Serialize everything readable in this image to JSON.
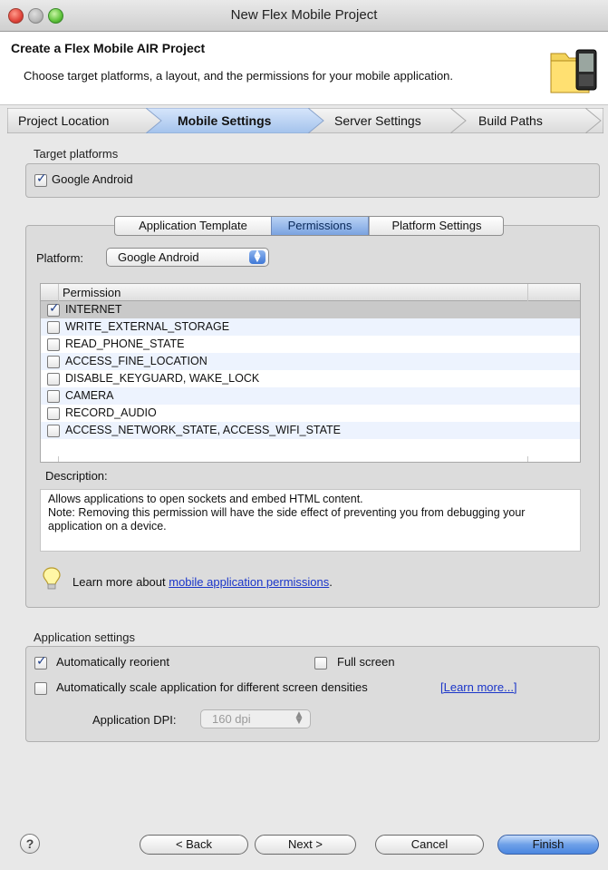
{
  "window": {
    "title": "New Flex Mobile Project"
  },
  "header": {
    "title": "Create a Flex Mobile AIR Project",
    "description": "Choose target platforms, a layout, and the permissions for your mobile application."
  },
  "breadcrumb": [
    {
      "label": "Project Location",
      "selected": false
    },
    {
      "label": "Mobile Settings",
      "selected": true
    },
    {
      "label": "Server Settings",
      "selected": false
    },
    {
      "label": "Build Paths",
      "selected": false
    }
  ],
  "target_platforms": {
    "label": "Target platforms",
    "items": [
      {
        "label": "Google Android",
        "checked": true
      }
    ]
  },
  "inner_tabs": [
    {
      "label": "Application Template",
      "selected": false
    },
    {
      "label": "Permissions",
      "selected": true
    },
    {
      "label": "Platform Settings",
      "selected": false
    }
  ],
  "platform": {
    "label": "Platform:",
    "value": "Google Android"
  },
  "permissions": {
    "column_header": "Permission",
    "rows": [
      {
        "name": "INTERNET",
        "checked": true,
        "selected": true
      },
      {
        "name": "WRITE_EXTERNAL_STORAGE",
        "checked": false,
        "selected": false
      },
      {
        "name": "READ_PHONE_STATE",
        "checked": false,
        "selected": false
      },
      {
        "name": "ACCESS_FINE_LOCATION",
        "checked": false,
        "selected": false
      },
      {
        "name": "DISABLE_KEYGUARD, WAKE_LOCK",
        "checked": false,
        "selected": false
      },
      {
        "name": "CAMERA",
        "checked": false,
        "selected": false
      },
      {
        "name": "RECORD_AUDIO",
        "checked": false,
        "selected": false
      },
      {
        "name": "ACCESS_NETWORK_STATE, ACCESS_WIFI_STATE",
        "checked": false,
        "selected": false
      }
    ]
  },
  "description": {
    "label": "Description:",
    "text_line1": "Allows applications to open sockets and embed HTML content.",
    "text_line2": "Note: Removing this permission will have the side effect of preventing you from debugging your application on a device."
  },
  "learn_more": {
    "prefix": "Learn more about ",
    "link": "mobile application permissions",
    "suffix": "."
  },
  "application_settings": {
    "label": "Application settings",
    "auto_reorient": {
      "label": "Automatically reorient",
      "checked": true
    },
    "full_screen": {
      "label": "Full screen",
      "checked": false
    },
    "auto_scale": {
      "label": "Automatically scale application for different screen densities",
      "checked": false
    },
    "learn_more_link": "[Learn more...]",
    "dpi_label": "Application DPI:",
    "dpi_value": "160 dpi"
  },
  "buttons": {
    "help": "?",
    "back": "< Back",
    "next": "Next >",
    "cancel": "Cancel",
    "finish": "Finish"
  },
  "colors": {
    "selection_blue": "#4a86e0",
    "row_alt": "#edf3fe",
    "link": "#1a35c9"
  }
}
